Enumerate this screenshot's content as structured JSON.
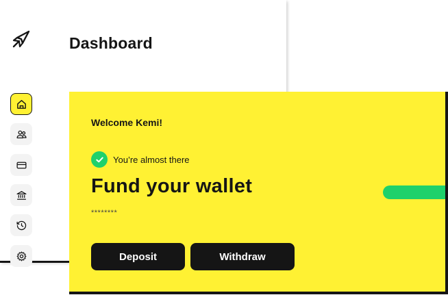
{
  "header": {
    "title": "Dashboard"
  },
  "sidebar": {
    "items": [
      {
        "icon": "home-icon",
        "active": true
      },
      {
        "icon": "users-icon",
        "active": false
      },
      {
        "icon": "card-icon",
        "active": false
      },
      {
        "icon": "bank-icon",
        "active": false
      },
      {
        "icon": "history-icon",
        "active": false
      },
      {
        "icon": "settings-icon",
        "active": false
      }
    ]
  },
  "card": {
    "welcome": "Welcome Kemi!",
    "status": "You’re almost there",
    "headline": "Fund your wallet",
    "masked_value": "********",
    "progress_fraction": 1.0,
    "deposit_label": "Deposit",
    "withdraw_label": "Withdraw"
  },
  "colors": {
    "accent_yellow": "#fff133",
    "success_green": "#1ed16b",
    "dark": "#151515"
  }
}
